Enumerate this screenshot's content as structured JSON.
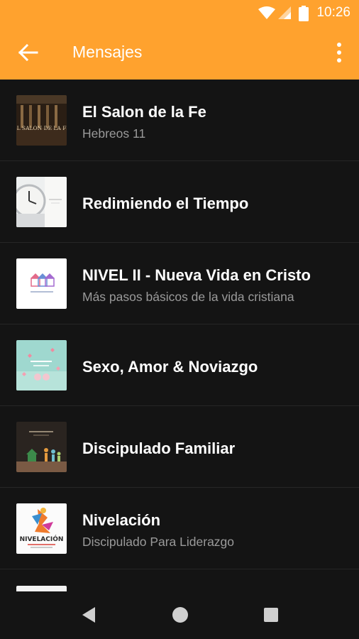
{
  "status_bar": {
    "time": "10:26",
    "icons": [
      "wifi-icon",
      "signal-icon",
      "battery-icon"
    ]
  },
  "toolbar": {
    "title": "Mensajes",
    "back_icon": "arrow-left-icon",
    "menu_icon": "more-vert-icon"
  },
  "colors": {
    "accent": "#ffa22e",
    "background": "#141414",
    "title_text": "#ffffff",
    "subtitle_text": "#9a9a9a"
  },
  "items": [
    {
      "title": "El Salon de la Fe",
      "subtitle": "Hebreos 11",
      "thumb_text": "EL SALON DE LA FE"
    },
    {
      "title": "Redimiendo el Tiempo",
      "subtitle": ""
    },
    {
      "title": "NIVEL II - Nueva Vida en Cristo",
      "subtitle": "Más pasos básicos de la vida cristiana"
    },
    {
      "title": "Sexo, Amor & Noviazgo",
      "subtitle": ""
    },
    {
      "title": "Discipulado Familiar",
      "subtitle": ""
    },
    {
      "title": "Nivelación",
      "subtitle": "Discipulado Para Liderazgo",
      "thumb_text": "NIVELACIÓN"
    }
  ],
  "nav_bar": {
    "buttons": [
      "back-triangle-icon",
      "home-circle-icon",
      "recents-square-icon"
    ]
  }
}
